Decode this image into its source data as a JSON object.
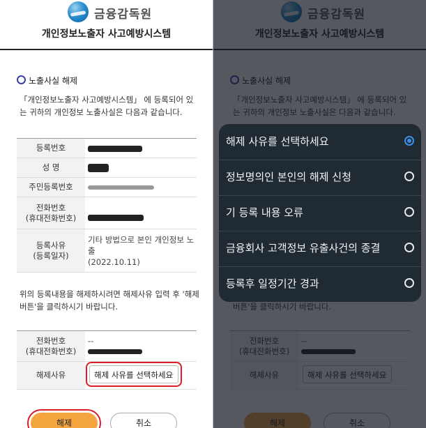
{
  "brand": {
    "name": "금융감독원",
    "system_title": "개인정보노출자 사고예방시스템"
  },
  "section": {
    "title": "노출사실 해제",
    "intro": "「개인정보노출자 사고예방시스템」 에 등록되어 있는 귀하의 개인정보 노출사실은 다음과 같습니다."
  },
  "info_table": {
    "reg_no_label": "등록번호",
    "name_label": "성 명",
    "rrn_label": "주민등록번호",
    "phone_label": "전화번호\n(휴대전화번호)",
    "reason_label": "등록사유\n(등록일자)",
    "reason_value": "기타 방법으로 본인 개인정보 노출",
    "reason_date": "(2022.10.11)"
  },
  "notice": "위의 등록내용을 해제하시려면 해제사유 입력 후 '해제 버튼'을 클릭하시기 바랍니다.",
  "release_form": {
    "phone_label": "전화번호\n(휴대전화번호)",
    "phone_value": "--",
    "reason_label": "해제사유",
    "select_value": "해제 사유를 선택하세요"
  },
  "buttons": {
    "release": "해제",
    "cancel": "취소"
  },
  "picker": {
    "options": [
      {
        "label": "해제 사유를 선택하세요",
        "selected": true
      },
      {
        "label": "정보명의인 본인의 해제 신청",
        "selected": false
      },
      {
        "label": "기 등록 내용 오류",
        "selected": false
      },
      {
        "label": "금융회사 고객정보 유출사건의 종결",
        "selected": false
      },
      {
        "label": "등록후 일정기간 경과",
        "selected": false
      }
    ],
    "accent_color": "#3b91e8"
  },
  "colors": {
    "release_button": "#f5a540",
    "highlight": "#d81e28",
    "section_icon": "#3b3fa8"
  }
}
